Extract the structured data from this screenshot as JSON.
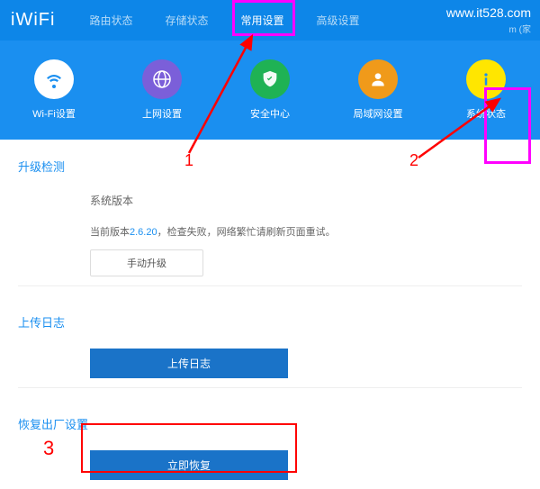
{
  "logo": "iWiFi",
  "watermark": "www.it528.com",
  "watermark_sub": "m (家",
  "topnav": {
    "items": [
      {
        "label": "路由状态"
      },
      {
        "label": "存储状态"
      },
      {
        "label": "常用设置"
      },
      {
        "label": "高级设置"
      }
    ]
  },
  "iconrow": {
    "items": [
      {
        "label": "Wi-Fi设置",
        "icon": "wifi-icon",
        "bg": "#ffffff",
        "fg": "#1a8ff0"
      },
      {
        "label": "上网设置",
        "icon": "globe-icon",
        "bg": "#7b5fd9",
        "fg": "#ffffff"
      },
      {
        "label": "安全中心",
        "icon": "shield-icon",
        "bg": "#1fb254",
        "fg": "#ffffff"
      },
      {
        "label": "局域网设置",
        "icon": "person-icon",
        "bg": "#f09a1a",
        "fg": "#ffffff"
      },
      {
        "label": "系统状态",
        "icon": "info-icon",
        "bg": "#ffe600",
        "fg": "#1a8ff0"
      }
    ]
  },
  "sections": {
    "upgrade": {
      "title": "升级检测",
      "version_label": "系统版本",
      "version_prefix": "当前版本",
      "version_num": "2.6.20",
      "version_suffix": "，检查失败，网络繁忙请刷新页面重试。",
      "manual_btn": "手动升级"
    },
    "logs": {
      "title": "上传日志",
      "btn": "上传日志"
    },
    "reset": {
      "title": "恢复出厂设置",
      "btn": "立即恢复"
    }
  },
  "annotations": {
    "n1": "1",
    "n2": "2",
    "n3": "3"
  }
}
